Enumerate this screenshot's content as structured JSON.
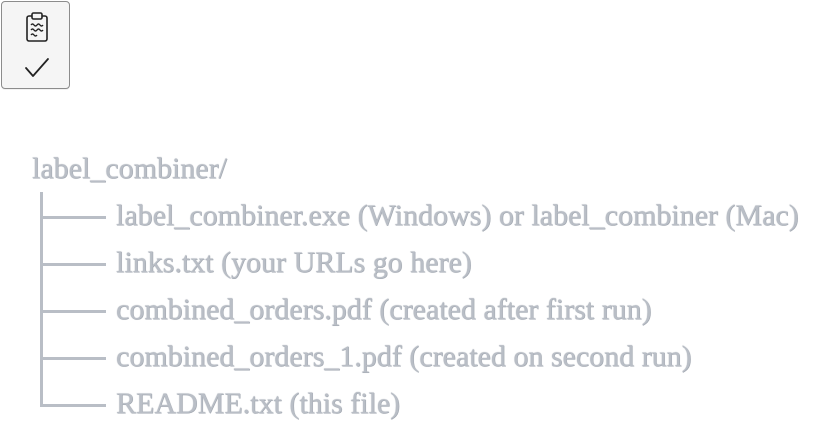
{
  "toolbar": {
    "copy_button_icon": "clipboard-icon",
    "copied_state_icon": "check-icon"
  },
  "tree": {
    "root": "label_combiner/",
    "children": [
      "label_combiner.exe (Windows) or label_combiner (Mac)",
      "links.txt (your URLs go here)",
      "combined_orders.pdf (created after first run)",
      "combined_orders_1.pdf (created on second run)",
      "README.txt (this file)"
    ]
  },
  "colors": {
    "text": "#b9bec6",
    "button_border": "#8c8c8c",
    "button_bg": "#f5f5f5"
  }
}
